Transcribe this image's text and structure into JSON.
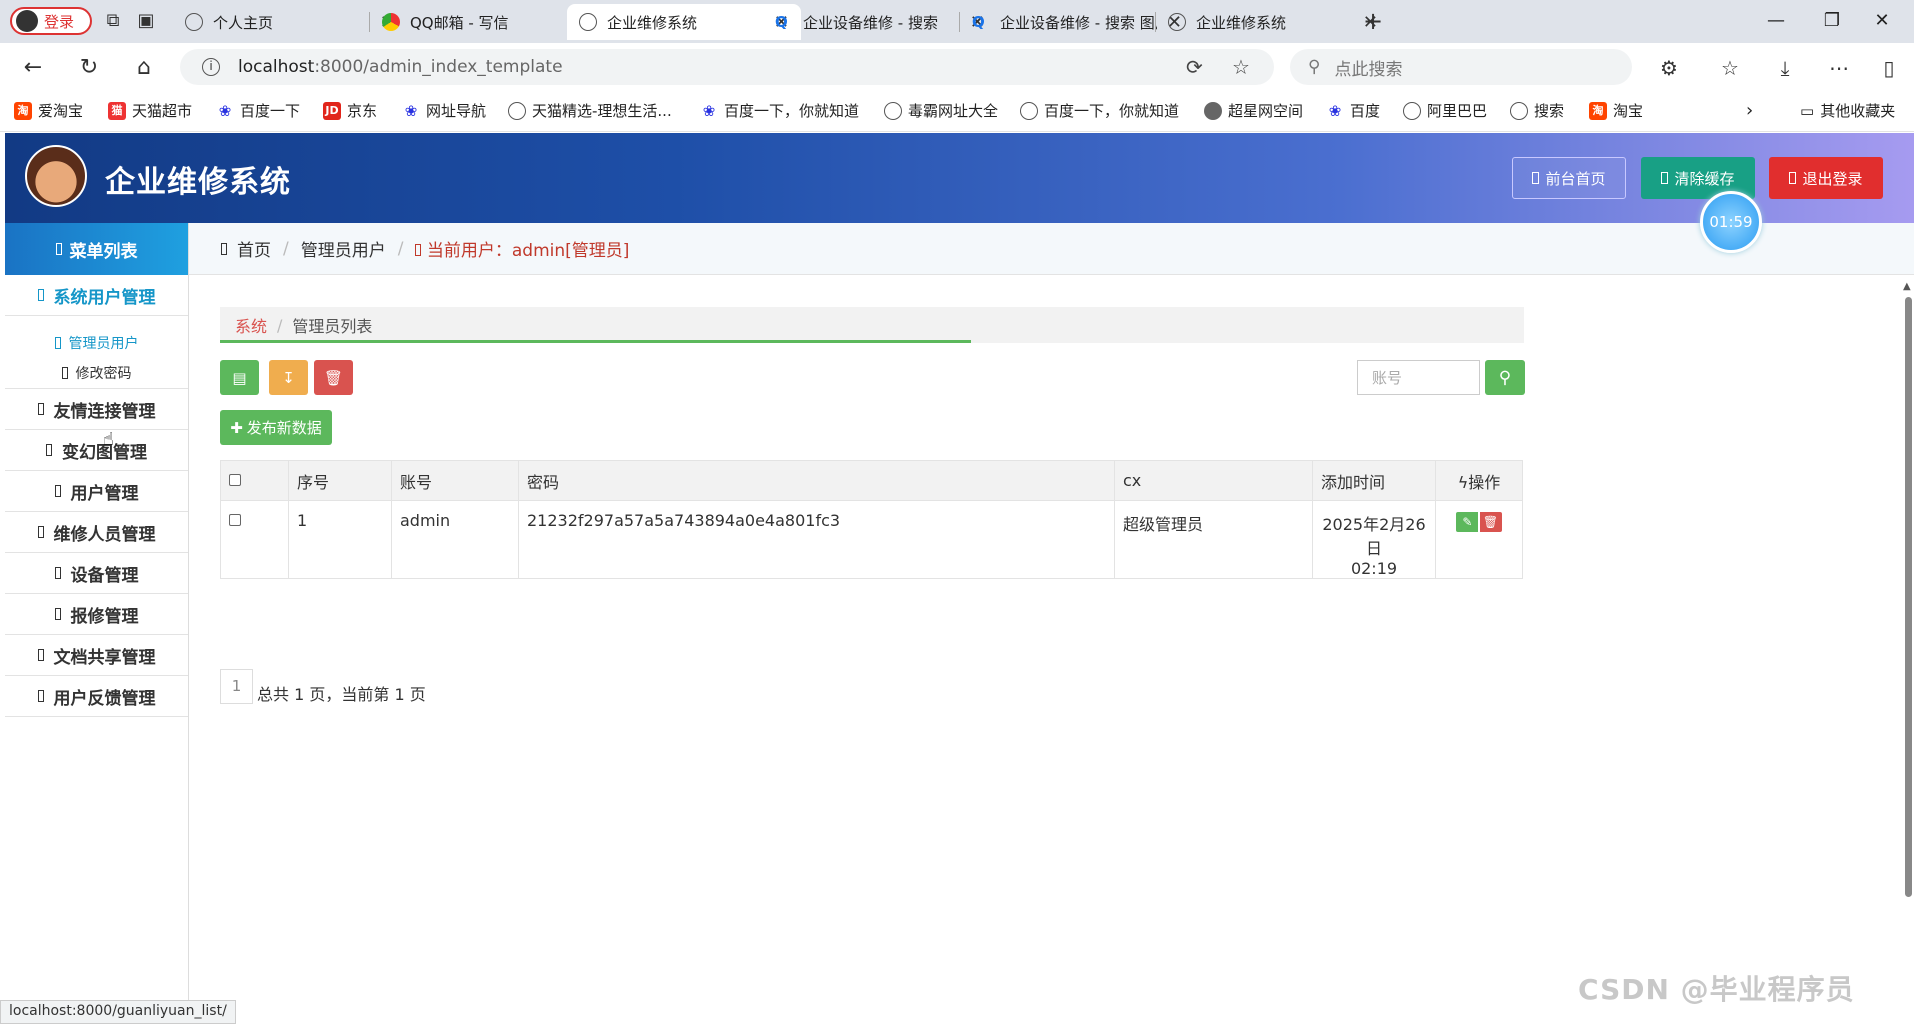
{
  "browser": {
    "login_label": "登录",
    "tabs": [
      {
        "title": "个人主页",
        "icon": "globe-icon"
      },
      {
        "title": "QQ邮箱 - 写信",
        "icon": "chrome-icon"
      },
      {
        "title": "企业维修系统",
        "icon": "globe-icon",
        "active": true
      },
      {
        "title": "企业设备维修 - 搜索",
        "icon": "search-icon"
      },
      {
        "title": "企业设备维修 - 搜索 图片",
        "icon": "search-icon"
      },
      {
        "title": "企业维修系统",
        "icon": "globe-icon"
      }
    ],
    "url_host": "localhost",
    "url_path": ":8000/admin_index_template",
    "search_placeholder": "点此搜索",
    "bookmarks": [
      "爱淘宝",
      "天猫超市",
      "百度一下",
      "京东",
      "网址导航",
      "天猫精选-理想生活...",
      "百度一下，你就知道",
      "毒霸网址大全",
      "百度一下，你就知道",
      "超星网空间",
      "百度",
      "阿里巴巴",
      "搜索",
      "淘宝"
    ],
    "other_bookmarks": "其他收藏夹",
    "status_url": "localhost:8000/guanliyuan_list/"
  },
  "app": {
    "title": "企业维修系统",
    "front_label": "前台首页",
    "cache_label": "清除缓存",
    "logout_label": "退出登录",
    "timer": "01:59"
  },
  "sidebar": {
    "header": "菜单列表",
    "open_menu": "系统用户管理",
    "sub_items": [
      "管理员用户",
      "修改密码"
    ],
    "menus": [
      "友情连接管理",
      "变幻图管理",
      "用户管理",
      "维修人员管理",
      "设备管理",
      "报修管理",
      "文档共享管理",
      "用户反馈管理"
    ]
  },
  "breadcrumb": {
    "home": "首页",
    "section": "管理员用户",
    "current_user": "当前用户：admin[管理员]"
  },
  "page": {
    "crumb_root": "系统",
    "crumb_current": "管理员列表",
    "account_placeholder": "账号",
    "publish_label": "发布新数据",
    "columns": [
      "序号",
      "账号",
      "密码",
      "cx",
      "添加时间",
      "操作"
    ],
    "rows": [
      {
        "no": "1",
        "account": "admin",
        "password": "21232f297a57a5a743894a0e4a801fc3",
        "cx": "超级管理员",
        "time_date": "2025年2月26日",
        "time_clock": "02:19"
      }
    ],
    "page_num": "1",
    "pager_text": "总共 1 页，当前第 1 页"
  },
  "watermark": "CSDN @毕业程序员"
}
